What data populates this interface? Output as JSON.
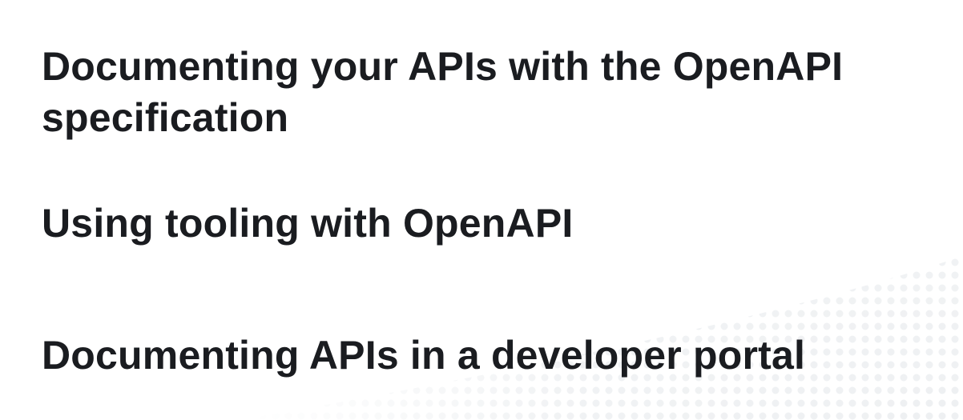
{
  "slide": {
    "topics": [
      {
        "text": "Documenting your APIs with the OpenAPI specification"
      },
      {
        "text": "Using tooling with OpenAPI"
      },
      {
        "text": "Documenting APIs in a developer portal"
      }
    ]
  },
  "colors": {
    "background": "#ffffff",
    "text": "#1a1c20",
    "pattern": "#eef0f2"
  }
}
